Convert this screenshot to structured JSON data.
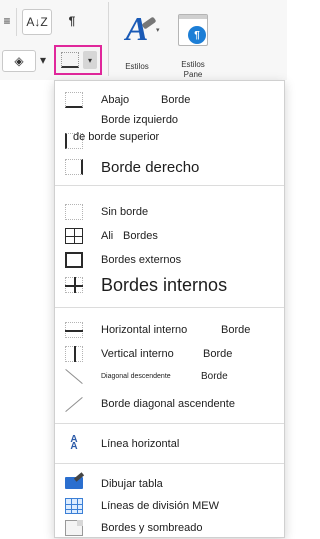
{
  "ribbon": {
    "sort_icon": "sort-az-icon",
    "sort_text": "A↓Z",
    "paragraph_mark": "¶",
    "shading_glyph": "◈",
    "dropdown_caret": "▾",
    "styles_label": "Estilos",
    "pane_line1": "Estilos",
    "pane_line2": "Pane",
    "pane_badge": "¶",
    "styles_glyph": "A"
  },
  "menu": {
    "bottom_border_a": "Abajo",
    "bottom_border_b": "Borde",
    "left_border_a": "Borde izquierdo",
    "left_border_b": "de borde superior",
    "right_border": "Borde derecho",
    "no_border": "Sin borde",
    "all_borders_a": "Ali",
    "all_borders_b": "Bordes",
    "outside_borders": "Bordes externos",
    "inside_borders": "Bordes internos",
    "horizontal_inside_a": "Horizontal interno",
    "horizontal_inside_b": "Borde",
    "vertical_inside_a": "Vertical interno",
    "vertical_inside_b": "Borde",
    "diagonal_down_a": "Diagonal descendente",
    "diagonal_down_b": "Borde",
    "diagonal_up": "Borde diagonal ascendente",
    "horizontal_line": "Línea horizontal",
    "draw_table": "Dibujar tabla",
    "gridlines": "Líneas de división MEW",
    "borders_shading": "Bordes y sombreado"
  },
  "colors": {
    "highlight": "#e0279b",
    "accent": "#2b5aa8"
  }
}
